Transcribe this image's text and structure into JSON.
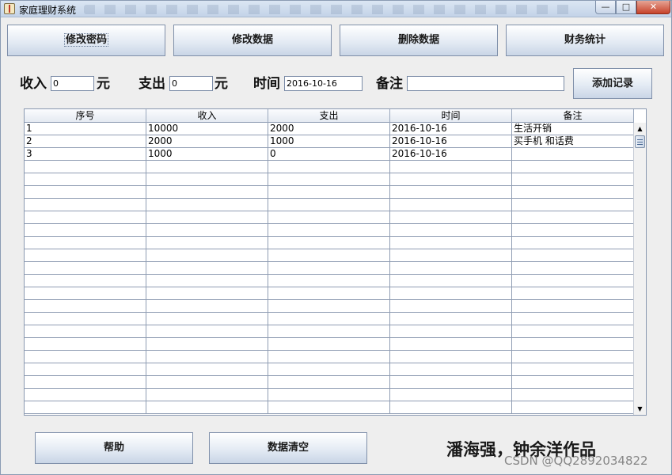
{
  "window": {
    "title": "家庭理财系统"
  },
  "top_buttons": [
    "修改密码",
    "修改数据",
    "删除数据",
    "财务统计"
  ],
  "form": {
    "income_label": "收入",
    "income_value": "0",
    "income_unit": "元",
    "expense_label": "支出",
    "expense_value": "0",
    "expense_unit": "元",
    "time_label": "时间",
    "time_value": "2016-10-16",
    "note_label": "备注",
    "note_value": "",
    "add_button": "添加记录"
  },
  "table": {
    "columns": [
      "序号",
      "收入",
      "支出",
      "时间",
      "备注"
    ],
    "rows": [
      [
        "1",
        "10000",
        "2000",
        "2016-10-16",
        "生活开销"
      ],
      [
        "2",
        "2000",
        "1000",
        "2016-10-16",
        " 买手机 和话费"
      ],
      [
        "3",
        "1000",
        "0",
        "2016-10-16",
        ""
      ]
    ],
    "scroll_up": "▲",
    "scroll_down": "▼"
  },
  "bottom_buttons": {
    "help": "帮助",
    "clear": "数据清空"
  },
  "credit": "潘海强，钟余洋作品",
  "watermark": "CSDN @QQ2892034822",
  "window_controls": {
    "minimize": "—",
    "maximize": "□",
    "close": "✕"
  }
}
